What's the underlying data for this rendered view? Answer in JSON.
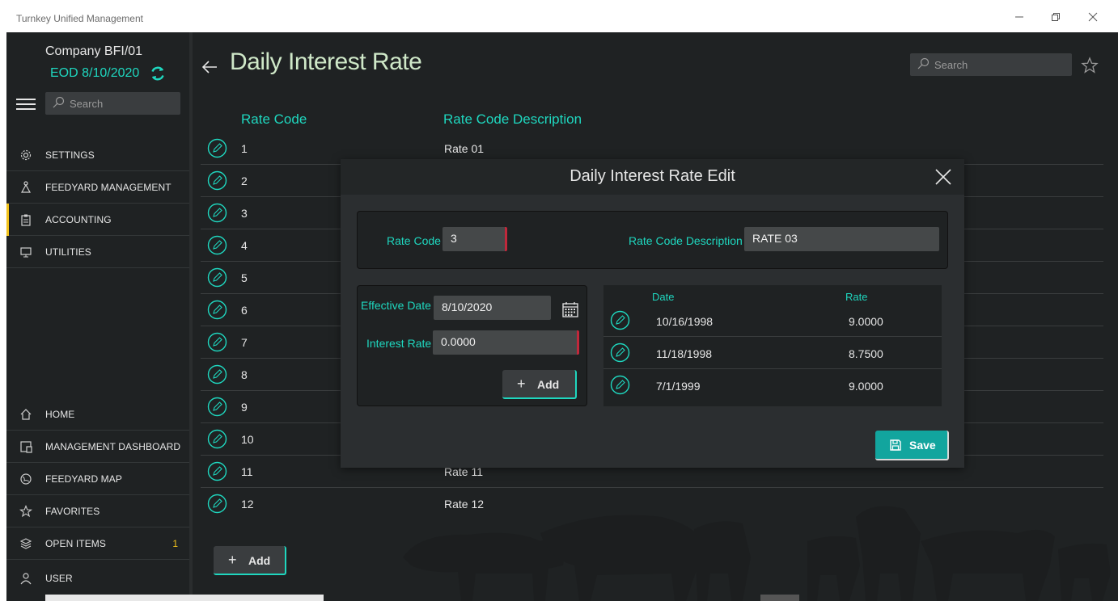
{
  "window": {
    "title": "Turnkey Unified Management",
    "controls": [
      "minimize",
      "restore",
      "close"
    ]
  },
  "sidebar": {
    "company": "Company BFI/01",
    "eod": "EOD 8/10/2020",
    "search_placeholder": "Search",
    "top_items": [
      {
        "label": "SETTINGS",
        "icon": "gear-icon"
      },
      {
        "label": "FEEDYARD MANAGEMENT",
        "icon": "feedyard-icon"
      },
      {
        "label": "ACCOUNTING",
        "icon": "clipboard-icon",
        "active": true
      },
      {
        "label": "UTILITIES",
        "icon": "monitor-icon"
      }
    ],
    "bottom_items": [
      {
        "label": "HOME",
        "icon": "home-icon"
      },
      {
        "label": "MANAGEMENT DASHBOARD",
        "icon": "dashboard-icon"
      },
      {
        "label": "FEEDYARD MAP",
        "icon": "globe-icon"
      },
      {
        "label": "FAVORITES",
        "icon": "star-icon"
      },
      {
        "label": "OPEN ITEMS",
        "icon": "layers-icon",
        "count": "1"
      },
      {
        "label": "USER",
        "icon": "user-icon"
      }
    ]
  },
  "main": {
    "title": "Daily Interest Rate",
    "search_placeholder": "Search",
    "columns": {
      "code": "Rate Code",
      "description": "Rate Code Description"
    },
    "rows": [
      {
        "code": "1",
        "description": "Rate 01"
      },
      {
        "code": "2",
        "description": ""
      },
      {
        "code": "3",
        "description": ""
      },
      {
        "code": "4",
        "description": ""
      },
      {
        "code": "5",
        "description": ""
      },
      {
        "code": "6",
        "description": ""
      },
      {
        "code": "7",
        "description": ""
      },
      {
        "code": "8",
        "description": ""
      },
      {
        "code": "9",
        "description": ""
      },
      {
        "code": "10",
        "description": ""
      },
      {
        "code": "11",
        "description": "Rate 11"
      },
      {
        "code": "12",
        "description": "Rate 12"
      }
    ],
    "add_label": "Add"
  },
  "modal": {
    "title": "Daily Interest Rate Edit",
    "rate_code_label": "Rate Code",
    "rate_code_value": "3",
    "rate_desc_label": "Rate Code Description",
    "rate_desc_value": "RATE 03",
    "effective_date_label": "Effective Date",
    "effective_date_value": "8/10/2020",
    "interest_rate_label": "Interest Rate",
    "interest_rate_value": "0.0000",
    "add_label": "Add",
    "grid": {
      "columns": {
        "date": "Date",
        "rate": "Rate"
      },
      "rows": [
        {
          "date": "10/16/1998",
          "rate": "9.0000"
        },
        {
          "date": "11/18/1998",
          "rate": "8.7500"
        },
        {
          "date": "7/1/1999",
          "rate": "9.0000"
        }
      ]
    },
    "save_label": "Save"
  },
  "colors": {
    "accent": "#1fd7bf",
    "active_marker": "#f1c21b",
    "required": "#c0283b",
    "save": "#12a59e"
  }
}
